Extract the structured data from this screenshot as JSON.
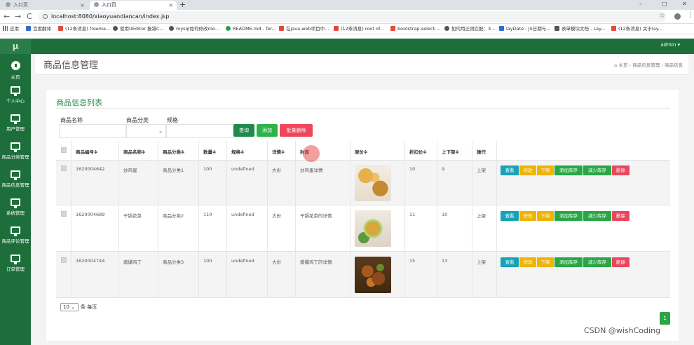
{
  "browser": {
    "tabs": [
      {
        "label": "入口页",
        "close": "×"
      },
      {
        "label": "入口页",
        "close": "×"
      }
    ],
    "new_tab": "+",
    "window_controls": {
      "minimize": "–",
      "maximize": "□",
      "close": "✕"
    },
    "nav": {
      "back": "←",
      "forward": "→",
      "reload": "C"
    },
    "url": "localhost:8080/xiaoyuandiancan/index.jsp",
    "bookmarks": [
      {
        "label": "应用",
        "color": "#e8453c"
      },
      {
        "label": "百度翻译",
        "color": "#2f6bd8"
      },
      {
        "label": "(12条消息) freema...",
        "color": "#e8453c"
      },
      {
        "label": "使用UEditor 报错C...",
        "color": "#555"
      },
      {
        "label": "mysql如何修改roo...",
        "color": "#555"
      },
      {
        "label": "README.md - Ter...",
        "color": "#2e9e4f"
      },
      {
        "label": "在java web项目中...",
        "color": "#e8453c"
      },
      {
        "label": "(12条消息) root of...",
        "color": "#e8453c"
      },
      {
        "label": "bootstrap-select-...",
        "color": "#e8453c"
      },
      {
        "label": "如何用正则匹配：3...",
        "color": "#555"
      },
      {
        "label": "layDate - JS日期与...",
        "color": "#2f6bd8"
      },
      {
        "label": "表单模块文档 - Lay...",
        "color": "#555"
      },
      {
        "label": "(12条消息) 关于lay...",
        "color": "#e8453c"
      }
    ]
  },
  "app": {
    "logo": "μ",
    "user_menu": "admin ▾",
    "sidebar": [
      {
        "label": "主页",
        "icon": "home-icon"
      },
      {
        "label": "个人中心",
        "icon": "monitor-icon"
      },
      {
        "label": "用户管理",
        "icon": "monitor-icon"
      },
      {
        "label": "商品分类管理",
        "icon": "monitor-icon"
      },
      {
        "label": "商品信息管理",
        "icon": "monitor-icon"
      },
      {
        "label": "系统管理",
        "icon": "monitor-icon"
      },
      {
        "label": "商品评论管理",
        "icon": "monitor-icon"
      },
      {
        "label": "订单管理",
        "icon": "monitor-icon"
      }
    ],
    "page_title": "商品信息管理",
    "breadcrumb": {
      "home": "⌂ 主页",
      "sep1": "›",
      "level1": "商品信息管理",
      "sep2": "›",
      "level2": "商品信息"
    }
  },
  "list": {
    "title": "商品信息列表",
    "filters": {
      "name_label": "商品名称",
      "category_label": "商品分类",
      "spec_label": "规格",
      "category_arrow": "⌄"
    },
    "buttons": {
      "search": "查询",
      "add": "添加",
      "batch_delete": "批量删除"
    },
    "columns": [
      "商品编号≑",
      "商品名称≑",
      "商品分类≑",
      "数量≑",
      "规格≑",
      "详情≑",
      "封面",
      "原价≑",
      "折扣价≑",
      "上下架≑",
      "操作"
    ],
    "rows": [
      {
        "id": "1620004642",
        "name": "炒鸡蛋",
        "category": "商品分类1",
        "qty": "100",
        "spec": "undefined",
        "size": "大份",
        "detail": "炒鸡蛋详情",
        "price": "10",
        "discount": "9",
        "status": "上架"
      },
      {
        "id": "1620004689",
        "name": "干锅花菜",
        "category": "商品分类2",
        "qty": "110",
        "spec": "undefined",
        "size": "大份",
        "detail": "干锅花菜的详情",
        "price": "11",
        "discount": "10",
        "status": "上架"
      },
      {
        "id": "1620004744",
        "name": "酱爆鸡丁",
        "category": "商品分类3",
        "qty": "100",
        "spec": "undefined",
        "size": "大份",
        "detail": "酱爆鸡丁的详情",
        "price": "15",
        "discount": "13",
        "status": "上架"
      }
    ],
    "actions": [
      "查看",
      "修改",
      "下架",
      "添加库存",
      "减少库存",
      "删除"
    ],
    "page_size": "10",
    "page_size_arrow": "⌄",
    "page_size_suffix": "条 每页",
    "current_page": "1"
  },
  "watermark": "CSDN @wishCoding",
  "colors": {
    "brand": "#1e6e3c",
    "search": "#1e8a4c",
    "add": "#2eb34a",
    "danger": "#f0455a",
    "view": "#17a2b8",
    "edit": "#f0b400",
    "stock": "#28a745",
    "delete": "#e8485c"
  }
}
